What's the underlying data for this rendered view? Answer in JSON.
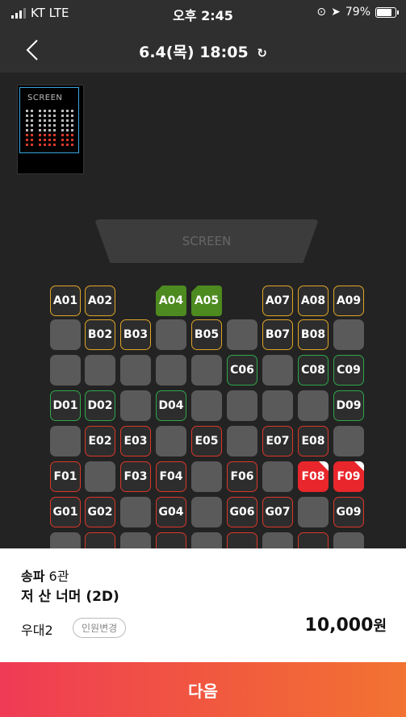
{
  "status_bar": {
    "carrier": "KT LTE",
    "time": "오후 2:45",
    "battery": "79%"
  },
  "nav": {
    "title": "6.4(목) 18:05",
    "refresh_icon": "↻"
  },
  "minimap": {
    "screen_label": "SCREEN"
  },
  "screen": {
    "label": "SCREEN"
  },
  "seats": [
    {
      "id": "A01",
      "state": "yellow"
    },
    {
      "id": "A02",
      "state": "yellow"
    },
    {
      "id": "",
      "state": "none"
    },
    {
      "id": "A04",
      "state": "selected-green"
    },
    {
      "id": "A05",
      "state": "selected-green"
    },
    {
      "id": "",
      "state": "none"
    },
    {
      "id": "A07",
      "state": "yellow"
    },
    {
      "id": "A08",
      "state": "yellow"
    },
    {
      "id": "A09",
      "state": "yellow"
    },
    {
      "id": "",
      "state": "empty"
    },
    {
      "id": "B02",
      "state": "yellow"
    },
    {
      "id": "B03",
      "state": "yellow"
    },
    {
      "id": "",
      "state": "empty"
    },
    {
      "id": "B05",
      "state": "yellow"
    },
    {
      "id": "",
      "state": "empty"
    },
    {
      "id": "B07",
      "state": "yellow"
    },
    {
      "id": "B08",
      "state": "yellow"
    },
    {
      "id": "",
      "state": "empty"
    },
    {
      "id": "",
      "state": "empty"
    },
    {
      "id": "",
      "state": "empty"
    },
    {
      "id": "",
      "state": "empty"
    },
    {
      "id": "",
      "state": "empty"
    },
    {
      "id": "",
      "state": "empty"
    },
    {
      "id": "C06",
      "state": "green"
    },
    {
      "id": "",
      "state": "empty"
    },
    {
      "id": "C08",
      "state": "green"
    },
    {
      "id": "C09",
      "state": "green"
    },
    {
      "id": "D01",
      "state": "green"
    },
    {
      "id": "D02",
      "state": "green"
    },
    {
      "id": "",
      "state": "empty"
    },
    {
      "id": "D04",
      "state": "green"
    },
    {
      "id": "",
      "state": "empty"
    },
    {
      "id": "",
      "state": "empty"
    },
    {
      "id": "",
      "state": "empty"
    },
    {
      "id": "",
      "state": "empty"
    },
    {
      "id": "D09",
      "state": "green"
    },
    {
      "id": "",
      "state": "empty"
    },
    {
      "id": "E02",
      "state": "red"
    },
    {
      "id": "E03",
      "state": "red"
    },
    {
      "id": "",
      "state": "empty"
    },
    {
      "id": "E05",
      "state": "red"
    },
    {
      "id": "",
      "state": "empty"
    },
    {
      "id": "E07",
      "state": "red"
    },
    {
      "id": "E08",
      "state": "red"
    },
    {
      "id": "",
      "state": "empty"
    },
    {
      "id": "F01",
      "state": "red"
    },
    {
      "id": "",
      "state": "empty"
    },
    {
      "id": "F03",
      "state": "red"
    },
    {
      "id": "F04",
      "state": "red"
    },
    {
      "id": "",
      "state": "empty"
    },
    {
      "id": "F06",
      "state": "red"
    },
    {
      "id": "",
      "state": "empty"
    },
    {
      "id": "F08",
      "state": "selected-red"
    },
    {
      "id": "F09",
      "state": "selected-red"
    },
    {
      "id": "G01",
      "state": "red"
    },
    {
      "id": "G02",
      "state": "red"
    },
    {
      "id": "",
      "state": "empty"
    },
    {
      "id": "G04",
      "state": "red"
    },
    {
      "id": "",
      "state": "empty"
    },
    {
      "id": "G06",
      "state": "red"
    },
    {
      "id": "G07",
      "state": "red"
    },
    {
      "id": "",
      "state": "empty"
    },
    {
      "id": "G09",
      "state": "red"
    },
    {
      "id": "",
      "state": "empty"
    },
    {
      "id": "",
      "state": "red"
    },
    {
      "id": "",
      "state": "empty"
    },
    {
      "id": "",
      "state": "red"
    },
    {
      "id": "",
      "state": "empty"
    },
    {
      "id": "",
      "state": "red"
    },
    {
      "id": "",
      "state": "empty"
    },
    {
      "id": "",
      "state": "red"
    },
    {
      "id": "",
      "state": "empty"
    }
  ],
  "booking": {
    "theater_name": "송파",
    "theater_hall": "6관",
    "movie_title": "저 산 너머 (2D)",
    "discount_label": "우대2",
    "change_people_label": "인원변경",
    "price": "10,000",
    "currency": "원"
  },
  "next_button": {
    "label": "다음"
  },
  "colors": {
    "accent_yellow": "#e0a526",
    "accent_green": "#2fa84a",
    "accent_red": "#d9382a",
    "selected_green": "#4d8a1f",
    "selected_red": "#e8262b"
  }
}
